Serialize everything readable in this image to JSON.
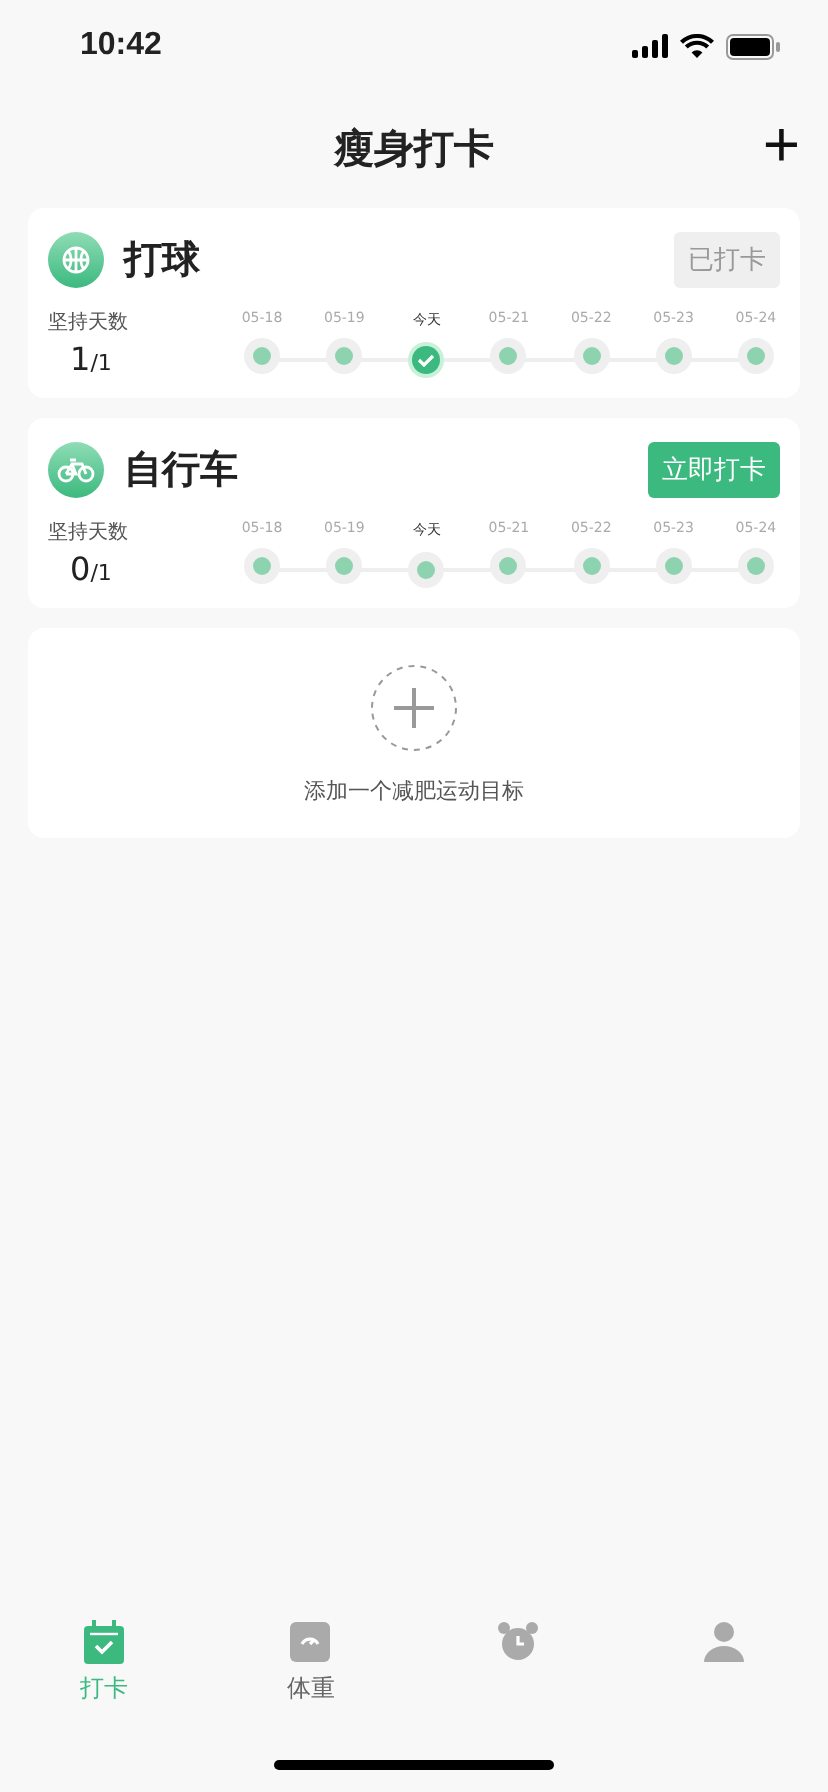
{
  "status_bar": {
    "time": "10:42"
  },
  "header": {
    "title": "瘦身打卡",
    "add": "+"
  },
  "habits": [
    {
      "name": "打球",
      "kind": "ball",
      "button": {
        "label": "已打卡",
        "disabled": true
      },
      "streak_label": "坚持天数",
      "count": "1",
      "goal": "/1",
      "days": [
        {
          "label": "05-18",
          "today": false,
          "checked": false
        },
        {
          "label": "05-19",
          "today": false,
          "checked": false
        },
        {
          "label": "今天",
          "today": true,
          "checked": true
        },
        {
          "label": "05-21",
          "today": false,
          "checked": false
        },
        {
          "label": "05-22",
          "today": false,
          "checked": false
        },
        {
          "label": "05-23",
          "today": false,
          "checked": false
        },
        {
          "label": "05-24",
          "today": false,
          "checked": false
        }
      ]
    },
    {
      "name": "自行车",
      "kind": "bike",
      "button": {
        "label": "立即打卡",
        "disabled": false
      },
      "streak_label": "坚持天数",
      "count": "0",
      "goal": "/1",
      "days": [
        {
          "label": "05-18",
          "today": false,
          "checked": false
        },
        {
          "label": "05-19",
          "today": false,
          "checked": false
        },
        {
          "label": "今天",
          "today": true,
          "checked": false
        },
        {
          "label": "05-21",
          "today": false,
          "checked": false
        },
        {
          "label": "05-22",
          "today": false,
          "checked": false
        },
        {
          "label": "05-23",
          "today": false,
          "checked": false
        },
        {
          "label": "05-24",
          "today": false,
          "checked": false
        }
      ]
    }
  ],
  "add_goal": {
    "label": "添加一个减肥运动目标"
  },
  "tabs": [
    {
      "kind": "calendar",
      "label": "打卡",
      "selected": true
    },
    {
      "kind": "scale",
      "label": "体重",
      "selected": false
    },
    {
      "kind": "alarm",
      "selected": false
    },
    {
      "kind": "person",
      "selected": false
    }
  ]
}
